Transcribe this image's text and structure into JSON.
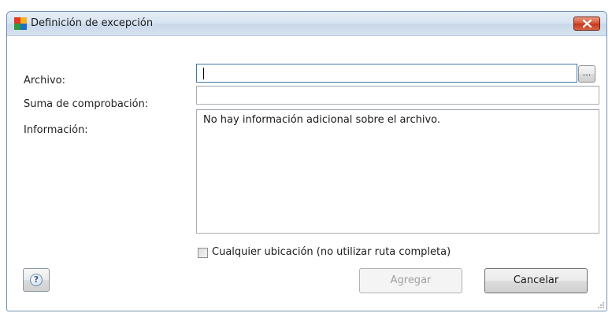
{
  "window": {
    "title": "Definición de excepción"
  },
  "form": {
    "file_label": "Archivo:",
    "file_value": "",
    "browse_label": "...",
    "checksum_label": "Suma de comprobación:",
    "checksum_value": "",
    "info_label": "Información:",
    "info_text": "No hay información adicional sobre el archivo.",
    "any_location_label": "Cualquier ubicación (no utilizar ruta completa)",
    "any_location_checked": false
  },
  "buttons": {
    "help_label": "?",
    "add_label": "Agregar",
    "add_enabled": false,
    "cancel_label": "Cancelar"
  },
  "icons": {
    "app": "avg-logo-icon",
    "close": "close-icon",
    "help": "help-icon"
  },
  "colors": {
    "titlebar": "#d7e3f0",
    "close_button": "#c94b2f",
    "field_focus_border": "#3d7bad",
    "disabled_text": "#a0a0a0"
  }
}
